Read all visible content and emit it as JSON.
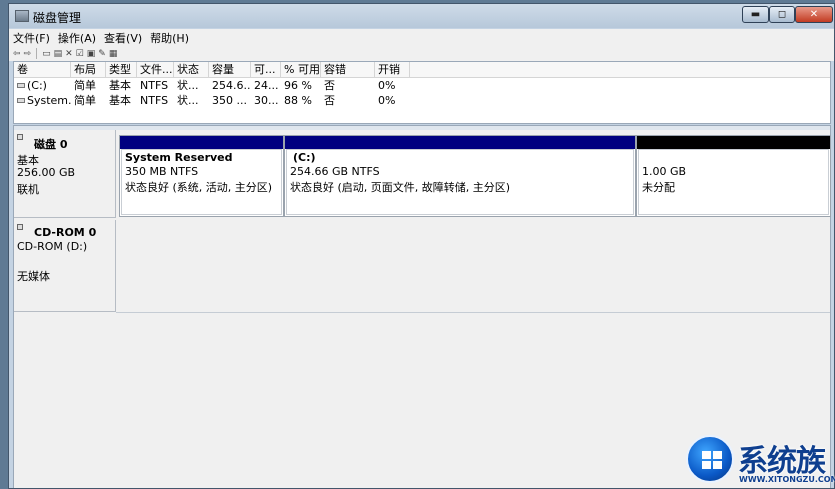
{
  "window": {
    "title": "磁盘管理",
    "controls": {
      "minimize": "▬",
      "maximize": "◻",
      "close": "✕"
    }
  },
  "menu": [
    "文件(F)",
    "操作(A)",
    "查看(V)",
    "帮助(H)"
  ],
  "toolbar": {
    "icons": [
      "back-icon",
      "forward-icon",
      "up-icon",
      "properties-icon",
      "delete-icon",
      "connect-icon",
      "disk-icon",
      "check-icon",
      "rescan-icon"
    ],
    "glyphs": [
      "⇦",
      "⇨",
      "▭",
      "▤",
      "✕",
      "☑",
      "▣",
      "✎",
      "▦"
    ]
  },
  "volume_table": {
    "headers": [
      "卷",
      "布局",
      "类型",
      "文件...",
      "状态",
      "容量",
      "可...",
      "% 可用",
      "容错",
      "开销"
    ],
    "rows": [
      [
        "(C:)",
        "简单",
        "基本",
        "NTFS",
        "状...",
        "254.6...",
        "24...",
        "96 %",
        "否",
        "0%"
      ],
      [
        "System...",
        "简单",
        "基本",
        "NTFS",
        "状...",
        "350 ...",
        "30...",
        "88 %",
        "否",
        "0%"
      ]
    ]
  },
  "disks": [
    {
      "name": "磁盘 0",
      "type": "基本",
      "size": "256.00 GB",
      "status": "联机",
      "partitions": [
        {
          "name": "System Reserved",
          "size": "350 MB NTFS",
          "status": "状态良好 (系统, 活动, 主分区)",
          "bar_color": "#000080"
        },
        {
          "name": "(C:)",
          "size": "254.66 GB NTFS",
          "status": "状态良好 (启动, 页面文件, 故障转储, 主分区)",
          "bar_color": "#000080"
        },
        {
          "name": "",
          "size": "1.00 GB",
          "status": "未分配",
          "bar_color": "#000000"
        }
      ]
    }
  ],
  "cdrom": {
    "name": "CD-ROM 0",
    "drive": "CD-ROM (D:)",
    "media": "无媒体"
  },
  "watermark": {
    "text": "系统族",
    "url": "WWW.XITONGZU.COM"
  }
}
